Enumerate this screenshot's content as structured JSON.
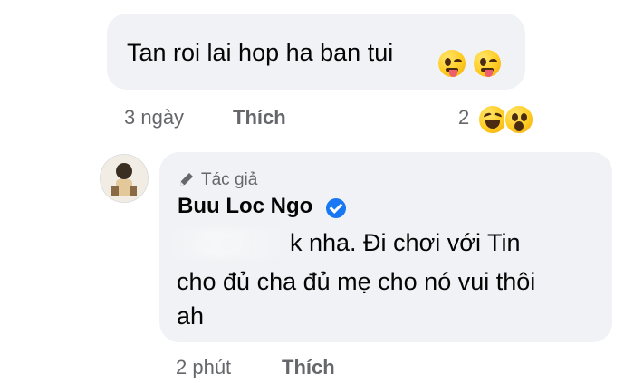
{
  "comment1": {
    "text": "Tan roi lai hop ha ban tui",
    "emojis": [
      "zany-face-icon",
      "zany-face-icon"
    ],
    "time": "3 ngày",
    "like_label": "Thích",
    "reaction_count": "2",
    "reactions": [
      "haha-reaction-icon",
      "wow-reaction-icon"
    ]
  },
  "comment2": {
    "author_badge": "Tác giả",
    "author_name": "Buu Loc Ngo",
    "lines": [
      "k nha. Đi chơi với Tin",
      "cho đủ cha đủ mẹ cho nó vui thôi",
      "ah"
    ],
    "time": "2 phút",
    "like_label": "Thích"
  },
  "colors": {
    "bubble": "#f0f2f5",
    "meta": "#65676b",
    "verified": "#1877f2"
  }
}
